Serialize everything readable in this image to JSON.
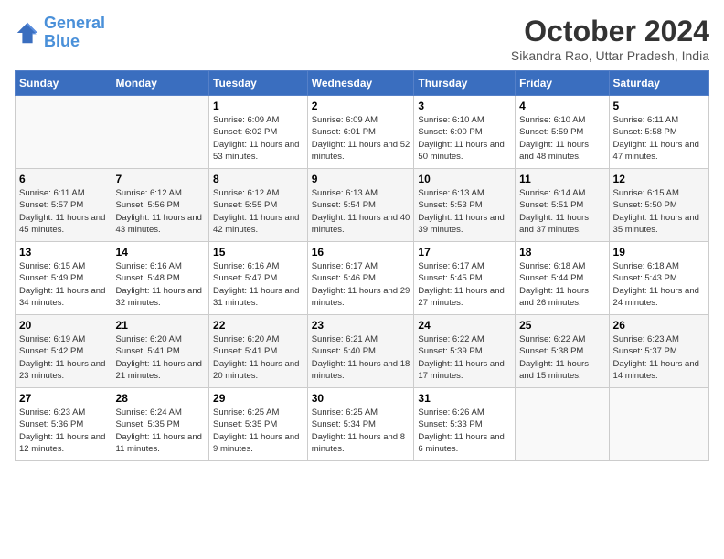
{
  "header": {
    "logo_line1": "General",
    "logo_line2": "Blue",
    "month_title": "October 2024",
    "subtitle": "Sikandra Rao, Uttar Pradesh, India"
  },
  "days_of_week": [
    "Sunday",
    "Monday",
    "Tuesday",
    "Wednesday",
    "Thursday",
    "Friday",
    "Saturday"
  ],
  "weeks": [
    [
      {
        "day": "",
        "info": ""
      },
      {
        "day": "",
        "info": ""
      },
      {
        "day": "1",
        "info": "Sunrise: 6:09 AM\nSunset: 6:02 PM\nDaylight: 11 hours and 53 minutes."
      },
      {
        "day": "2",
        "info": "Sunrise: 6:09 AM\nSunset: 6:01 PM\nDaylight: 11 hours and 52 minutes."
      },
      {
        "day": "3",
        "info": "Sunrise: 6:10 AM\nSunset: 6:00 PM\nDaylight: 11 hours and 50 minutes."
      },
      {
        "day": "4",
        "info": "Sunrise: 6:10 AM\nSunset: 5:59 PM\nDaylight: 11 hours and 48 minutes."
      },
      {
        "day": "5",
        "info": "Sunrise: 6:11 AM\nSunset: 5:58 PM\nDaylight: 11 hours and 47 minutes."
      }
    ],
    [
      {
        "day": "6",
        "info": "Sunrise: 6:11 AM\nSunset: 5:57 PM\nDaylight: 11 hours and 45 minutes."
      },
      {
        "day": "7",
        "info": "Sunrise: 6:12 AM\nSunset: 5:56 PM\nDaylight: 11 hours and 43 minutes."
      },
      {
        "day": "8",
        "info": "Sunrise: 6:12 AM\nSunset: 5:55 PM\nDaylight: 11 hours and 42 minutes."
      },
      {
        "day": "9",
        "info": "Sunrise: 6:13 AM\nSunset: 5:54 PM\nDaylight: 11 hours and 40 minutes."
      },
      {
        "day": "10",
        "info": "Sunrise: 6:13 AM\nSunset: 5:53 PM\nDaylight: 11 hours and 39 minutes."
      },
      {
        "day": "11",
        "info": "Sunrise: 6:14 AM\nSunset: 5:51 PM\nDaylight: 11 hours and 37 minutes."
      },
      {
        "day": "12",
        "info": "Sunrise: 6:15 AM\nSunset: 5:50 PM\nDaylight: 11 hours and 35 minutes."
      }
    ],
    [
      {
        "day": "13",
        "info": "Sunrise: 6:15 AM\nSunset: 5:49 PM\nDaylight: 11 hours and 34 minutes."
      },
      {
        "day": "14",
        "info": "Sunrise: 6:16 AM\nSunset: 5:48 PM\nDaylight: 11 hours and 32 minutes."
      },
      {
        "day": "15",
        "info": "Sunrise: 6:16 AM\nSunset: 5:47 PM\nDaylight: 11 hours and 31 minutes."
      },
      {
        "day": "16",
        "info": "Sunrise: 6:17 AM\nSunset: 5:46 PM\nDaylight: 11 hours and 29 minutes."
      },
      {
        "day": "17",
        "info": "Sunrise: 6:17 AM\nSunset: 5:45 PM\nDaylight: 11 hours and 27 minutes."
      },
      {
        "day": "18",
        "info": "Sunrise: 6:18 AM\nSunset: 5:44 PM\nDaylight: 11 hours and 26 minutes."
      },
      {
        "day": "19",
        "info": "Sunrise: 6:18 AM\nSunset: 5:43 PM\nDaylight: 11 hours and 24 minutes."
      }
    ],
    [
      {
        "day": "20",
        "info": "Sunrise: 6:19 AM\nSunset: 5:42 PM\nDaylight: 11 hours and 23 minutes."
      },
      {
        "day": "21",
        "info": "Sunrise: 6:20 AM\nSunset: 5:41 PM\nDaylight: 11 hours and 21 minutes."
      },
      {
        "day": "22",
        "info": "Sunrise: 6:20 AM\nSunset: 5:41 PM\nDaylight: 11 hours and 20 minutes."
      },
      {
        "day": "23",
        "info": "Sunrise: 6:21 AM\nSunset: 5:40 PM\nDaylight: 11 hours and 18 minutes."
      },
      {
        "day": "24",
        "info": "Sunrise: 6:22 AM\nSunset: 5:39 PM\nDaylight: 11 hours and 17 minutes."
      },
      {
        "day": "25",
        "info": "Sunrise: 6:22 AM\nSunset: 5:38 PM\nDaylight: 11 hours and 15 minutes."
      },
      {
        "day": "26",
        "info": "Sunrise: 6:23 AM\nSunset: 5:37 PM\nDaylight: 11 hours and 14 minutes."
      }
    ],
    [
      {
        "day": "27",
        "info": "Sunrise: 6:23 AM\nSunset: 5:36 PM\nDaylight: 11 hours and 12 minutes."
      },
      {
        "day": "28",
        "info": "Sunrise: 6:24 AM\nSunset: 5:35 PM\nDaylight: 11 hours and 11 minutes."
      },
      {
        "day": "29",
        "info": "Sunrise: 6:25 AM\nSunset: 5:35 PM\nDaylight: 11 hours and 9 minutes."
      },
      {
        "day": "30",
        "info": "Sunrise: 6:25 AM\nSunset: 5:34 PM\nDaylight: 11 hours and 8 minutes."
      },
      {
        "day": "31",
        "info": "Sunrise: 6:26 AM\nSunset: 5:33 PM\nDaylight: 11 hours and 6 minutes."
      },
      {
        "day": "",
        "info": ""
      },
      {
        "day": "",
        "info": ""
      }
    ]
  ]
}
